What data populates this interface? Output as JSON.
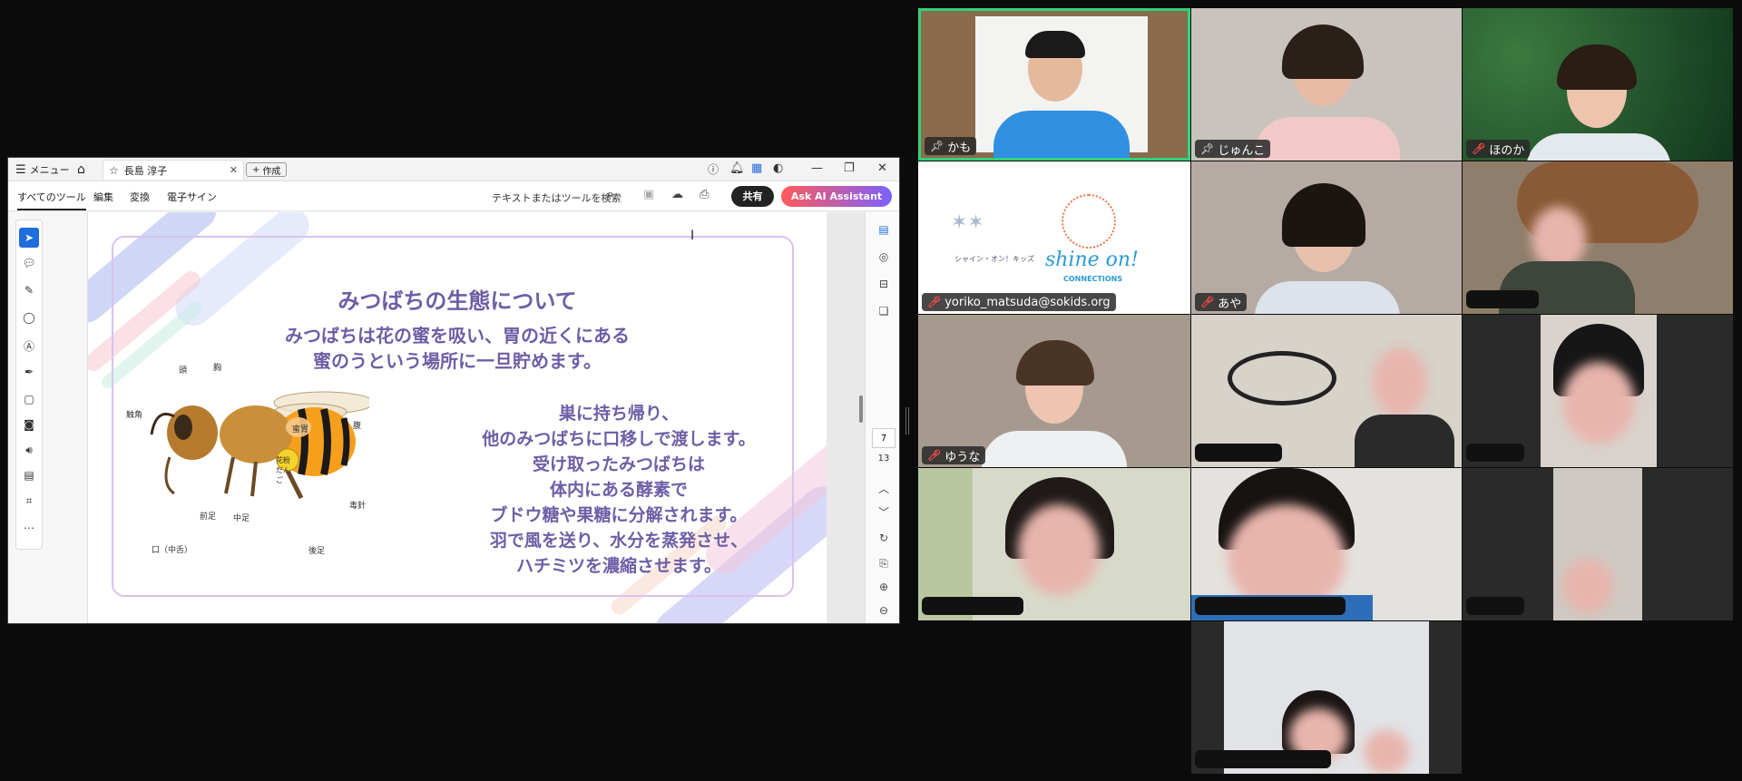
{
  "pdf_viewer": {
    "menu_label": "メニュー",
    "doc_tab_title": "長島 淳子",
    "create_label": "作成",
    "tools": {
      "all_tools": "すべてのツール",
      "edit": "編集",
      "convert": "変換",
      "esign": "電子サイン"
    },
    "search_placeholder": "テキストまたはツールを検索",
    "share_label": "共有",
    "ai_label": "Ask AI Assistant",
    "page_current": "7",
    "page_total": "13"
  },
  "slide": {
    "title": "みつばちの生態について",
    "line1": "みつばちは花の蜜を吸い、胃の近くにある",
    "line2": "蜜のうという場所に一旦貯めます。",
    "paragraph": [
      "巣に持ち帰り、",
      "他のみつばちに口移しで渡します。",
      "受け取ったみつばちは",
      "体内にある酵素で",
      "ブドウ糖や果糖に分解されます。",
      "羽で風を送り、水分を蒸発させ、",
      "ハチミツを濃縮させます。"
    ],
    "bee_labels": {
      "head": "頭",
      "chest": "胸",
      "antenna": "触角",
      "honey_sac": "蜜胃",
      "abdomen": "腹",
      "pollen": "花粉だんご",
      "foreleg": "前足",
      "midleg": "中足",
      "stinger": "毒針",
      "hindleg": "後足",
      "mouth": "口（中舌）"
    }
  },
  "gallery": {
    "kamo": "かも",
    "junko": "じゅんこ",
    "honoka": "ほのか",
    "yoriko": "yoriko_matsuda@sokids.org",
    "aya": "あや",
    "yuuna": "ゆうな",
    "logo_text_kids": "シャイン・オン！キッズ",
    "logo_text_shine": "shine on!",
    "logo_text_conn": "CONNECTIONS"
  }
}
